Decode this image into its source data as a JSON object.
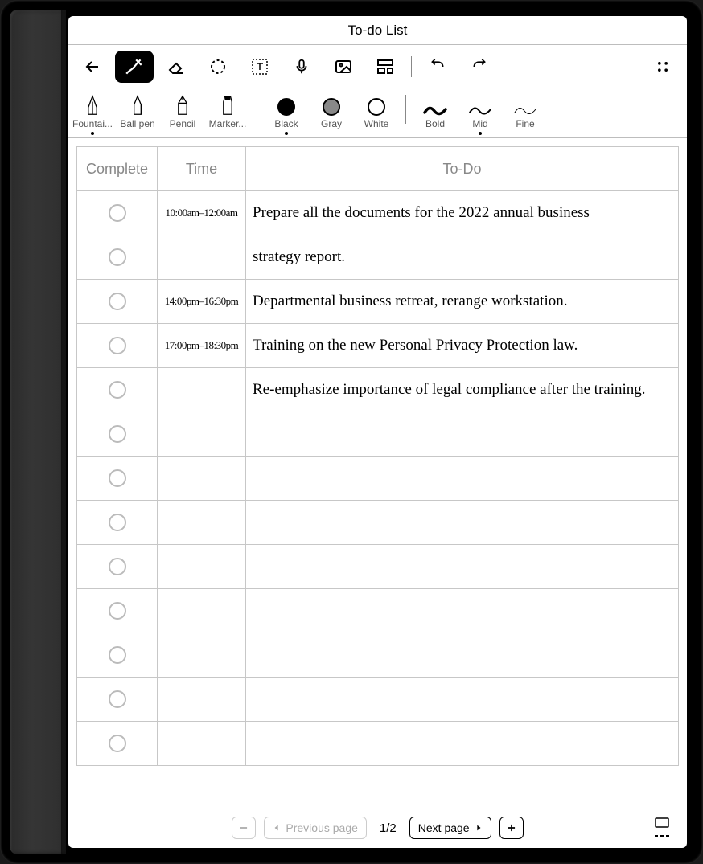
{
  "title": "To-do List",
  "tools": {
    "pen_types": [
      {
        "label": "Fountai..."
      },
      {
        "label": "Ball pen"
      },
      {
        "label": "Pencil"
      },
      {
        "label": "Marker..."
      }
    ],
    "colors": [
      {
        "label": "Black"
      },
      {
        "label": "Gray"
      },
      {
        "label": "White"
      }
    ],
    "strokes": [
      {
        "label": "Bold"
      },
      {
        "label": "Mid"
      },
      {
        "label": "Fine"
      }
    ]
  },
  "table": {
    "headers": {
      "complete": "Complete",
      "time": "Time",
      "todo": "To-Do"
    },
    "rows": [
      {
        "time": "10:00am–12:00am",
        "todo": "Prepare all the documents for the 2022 annual business"
      },
      {
        "time": "",
        "todo": "strategy report."
      },
      {
        "time": "14:00pm–16:30pm",
        "todo": "Departmental business retreat, rerange workstation."
      },
      {
        "time": "17:00pm–18:30pm",
        "todo": "Training on the new Personal Privacy Protection law."
      },
      {
        "time": "",
        "todo": "Re-emphasize importance of legal compliance after the training."
      },
      {
        "time": "",
        "todo": ""
      },
      {
        "time": "",
        "todo": ""
      },
      {
        "time": "",
        "todo": ""
      },
      {
        "time": "",
        "todo": ""
      },
      {
        "time": "",
        "todo": ""
      },
      {
        "time": "",
        "todo": ""
      },
      {
        "time": "",
        "todo": ""
      },
      {
        "time": "",
        "todo": ""
      }
    ]
  },
  "pagination": {
    "prev_label": "Previous page",
    "next_label": "Next page",
    "indicator": "1/2"
  }
}
